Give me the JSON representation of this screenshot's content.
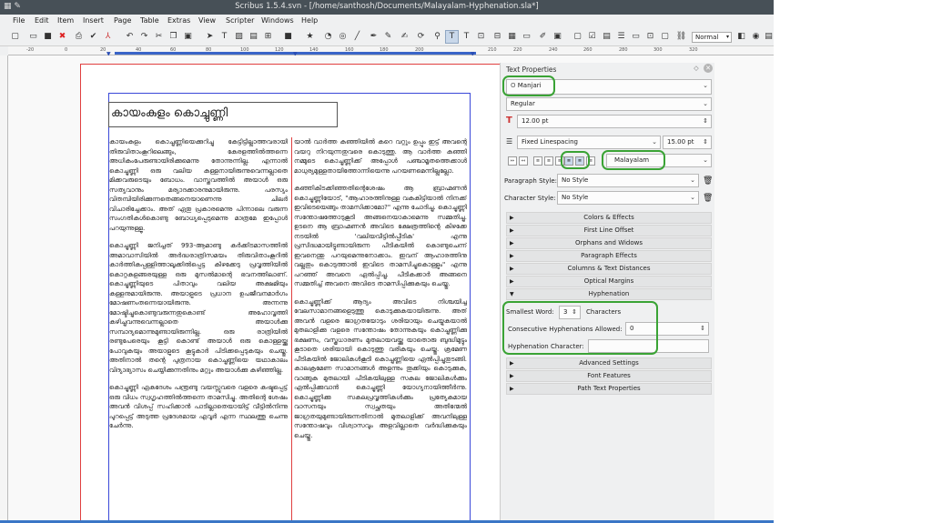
{
  "window": {
    "title": "Scribus 1.5.4.svn - [/home/santhosh/Documents/Malayalam-Hyphenation.sla*]"
  },
  "menu": [
    "File",
    "Edit",
    "Item",
    "Insert",
    "Page",
    "Table",
    "Extras",
    "View",
    "Scripter",
    "Windows",
    "Help"
  ],
  "toolbar": {
    "zoom_mode": "Normal"
  },
  "ruler": {
    "ticks": [
      "-20",
      "0",
      "20",
      "40",
      "60",
      "80",
      "100",
      "120",
      "140",
      "160",
      "180",
      "200",
      "210",
      "220",
      "240",
      "260",
      "280",
      "300",
      "320"
    ]
  },
  "document": {
    "heading": "കായംകുളം കൊച്ചുണ്ണി",
    "col1": [
      "കായംകുളം കൊച്ചുണ്ണിയെക്കുറിച്ചു കേട്ടിട്ടില്ലാത്തവരായി തിരുവിതാംകൂറിലെങ്ങും, കേരളത്തിൽത്തന്നെ അധികംപേരുണ്ടായിരിക്കുമെന്നു തോന്നുന്നില്ല. എന്നാൽ കൊച്ചുണ്ണി ഒരു വലിയ കള്ളനായിരുന്നുവെന്നല്ലാതെ മിക്കവരുടെയും ബോധം. വാസ്തവത്തിൽ അയാൾ ഒരു സത്യവാനും മര്യാദക്കാരനുമായിരുന്നു. പരസ്യം വിതമ്പിയിരിക്കുന്നതെങ്ങനെയാണെന്നു ചിലർ വിചാരിച്ചേക്കാം. അത് ഏതു പ്രകാരമെന്നു പിന്നാലെ വരുന്ന സംഗതികൾകൊണ്ടു ബോധ്യപ്പെടുമെന്നു മാത്രമേ ഇപ്പോൾ പറയുന്നുള്ളൂ.",
      "കൊച്ചുണ്ണി ജനിച്ചത് 993-ആമാണ്ടു കർക്കിടമാസത്തിൽ അമാവാസിയിൽ അർദ്ധരാത്രിസമയം തിരുവിതാംകൂറിൽ കാർത്തികപ്പള്ളിത്താലൂക്കിൽപ്പെട്ട കിഴക്കേടു പ്രവൃത്തിയിൽ കൊറ്റകുളങ്ങരയുള്ള ഒരു മുസൽമാന്റെ ഭവനത്തിലാണ്. കൊച്ചുണ്ണിയുടെ പിതാവും വലിയ അക്ഷമിയും കള്ളനുമായിരുന്നു. അയാളുടെ പ്രധാന ഉപജീവനമാർഗം മോഷണംതന്നെയായിരുന്നു. അന്നന്നു മോഷ്ടിച്ചുകൊണ്ടുവരുന്നതുകൊണ്ട് അഹോവൃത്തി കഴിച്ചുവന്നുവെന്നല്ലാതെ അയാൾക്കു സമ്പാദ്യമൊന്നുമുണ്ടായിരുന്നില്ല. ഒരു രാത്രിയിൽ രണ്ടുപേരെയും കൂട്ടി കൊണ്ട് അയാൾ ഒരു കൊള്ളയ്ക്കു പോവുകയും അയാളുടെ കൂട്ടുകാർ പിടിക്കപ്പെടുകയും ചെയ്തു. അതിനാൽ തന്റെ പുത്രനായ കൊച്ചുണ്ണിയെ യഥാകാലം വിദ്യാഭ്യാസം ചെയ്യിക്കുന്നതിനും മറ്റും അയാൾക്കു കഴിഞ്ഞില്ല.",
      "കൊച്ചുണ്ണി ഏകദേശം പന്ത്രണ്ടു വയസ്സുവരെ വളരെ കഷ്ടപ്പെട്ട് ഒരു വിധം സ്വഗൃഹത്തിൽത്തന്നെ താമസിച്ചു. അതിന്റെ ശേഷം അവൻ വിശപ്പ് സഹിക്കാൻ പാടില്ലാതെയായിട്ട് വീട്ടിൽനിന്നു പുറപ്പെട്ട് അടുത്ത പ്രദേശമായ എവൂർ എന്ന സ്ഥലത്തു ചെന്നു ചേർന്നു."
    ],
    "col2": [
      "യാൽ വാർത്ത കഞ്ഞിയിൽ കറെ വറ്റും ഉപ്പും ഇട്ട് അവന്റെ വയറു നിറയുന്നതുവരെ കൊടുത്തു. ആ വാർത്ത കഞ്ഞി നമ്മുടെ കൊച്ചുണ്ണിക്ക് അപ്പോൾ പഞ്ചാമൃതത്തെക്കാൾ മാധുര്യമുള്ളതായിത്തോന്നിയെന്നു പറയണമെന്നില്ലല്ലോ.",
      "കഞ്ഞികിടക്കിഞ്ഞതിന്റെശേഷം ആ ബ്രാഹ്മണൻ കൊച്ചുണ്ണിയോട്, \"ആഹാരത്തിനുള്ള വകകിട്ടിയാൽ നിനക്ക് ഇവിടെയെങ്ങും താമസിക്കാമോ?\" എന്നു ചോദിച്ചു. കൊച്ചുണ്ണി സന്തോഷത്തോടുകൂടി അങ്ങനെയാകാമെന്നു സമ്മതിച്ചു. ഉടനെ ആ ബ്രാഹ്മണൻ അവിടെ ക്ഷേത്രത്തിന്റെ കിഴക്കേ നടയിൽ 'വലിയവീട്ടിൽപ്പീടിക' എന്നു പ്രസിദ്ധമായിട്ടുണ്ടായിരുന്ന പീടികയിൽ കൊണ്ടുചെന്ന് ഇവനെന്തു പറയുമെന്നുനോക്കാം. ഇവന് ആഹാരത്തിനു വല്ലതും കൊടുത്താൽ ഇവിടെ താമസിച്ചുകൊള്ളും\" എന്നു പറഞ്ഞ് അവനെ ഏൽപ്പിച്ചു. പീടികക്കാർ അങ്ങനെ സമ്മതിച്ച് അവനെ അവിടെ താമസിപ്പിക്കുകയും ചെയ്തു.",
      "കൊച്ചുണ്ണിക്ക് ആദ്യം അവിടെ നിശ്ചയിച്ച വേലസാമാനങ്ങളെടുത്തു കൊടുക്കുകയായിരുന്നു. അത് അവൻ വളരെ ജാഗ്രതയോടും ശരിയായും ചെയ്യുകയാൽ മുതലാളിക്കു വളരെ സന്തോഷം തോന്നുകയും കൊച്ചുണ്ണിക്കു ഭക്ഷണം, വസ്ത്രധാരണം മുതലായവയ്ക്കു യാതൊരു ബുദ്ധിമുട്ടും കൂടാതെ ശരിയായി കൊടുത്തു വരികയും ചെയ്തു. ക്രമേണ പീടികയിൽ ജോലികൾകൂടി കൊച്ചുണ്ണിയെ ഏൽപ്പിച്ചുതുടങ്ങി. കാലക്രമേണ സാമാനങ്ങൾ അളന്നും തൂക്കിയും കൊടുക്കുക, വാങ്ങുക മുതലായി പീടികയിലുള്ള സകല ജോലികൾക്കും ഏൽപ്പിക്കുവാൻ കൊച്ചുണ്ണി യോഗ്യനായിത്തീർന്നു. കൊച്ചുണ്ണിക്കു സകലപ്രവൃത്തികൾക്കും പ്രത്യേകമായ വാസനയും സ്വച്ഛതയും അതിന്മേൽ ജാഗ്രതയുമുണ്ടായിരുന്നതിനാൽ മുതലാളിക്ക് അവനിലുള്ള സന്തോഷവും വിശ്വാസവും അളവില്ലാതെ വർദ്ധിക്കുകയും ചെയ്തു."
    ]
  },
  "panel": {
    "title": "Text Properties",
    "font_family": "Manjari",
    "font_style": "Regular",
    "font_size": "12.00 pt",
    "line_spacing_mode": "Fixed Linespacing",
    "line_spacing": "15.00 pt",
    "language": "Malayalam",
    "paragraph_style_label": "Paragraph Style:",
    "paragraph_style": "No Style",
    "character_style_label": "Character Style:",
    "character_style": "No Style",
    "sections_top": [
      "Colors & Effects",
      "First Line Offset",
      "Orphans and Widows",
      "Paragraph Effects",
      "Columns & Text Distances",
      "Optical Margins"
    ],
    "hyphenation": {
      "title": "Hyphenation",
      "smallest_word_label": "Smallest Word:",
      "smallest_word": "3",
      "characters_label": "Characters",
      "consecutive_label": "Consecutive Hyphenations Allowed:",
      "consecutive": "0",
      "char_label": "Hyphenation Character:",
      "char_value": ""
    },
    "sections_bottom": [
      "Advanced Settings",
      "Font Features",
      "Path Text Properties"
    ]
  },
  "colors": {
    "highlight": "#3aa335",
    "frame": "#3a48d8",
    "margin": "#e04040",
    "titlebar": "#475057"
  }
}
